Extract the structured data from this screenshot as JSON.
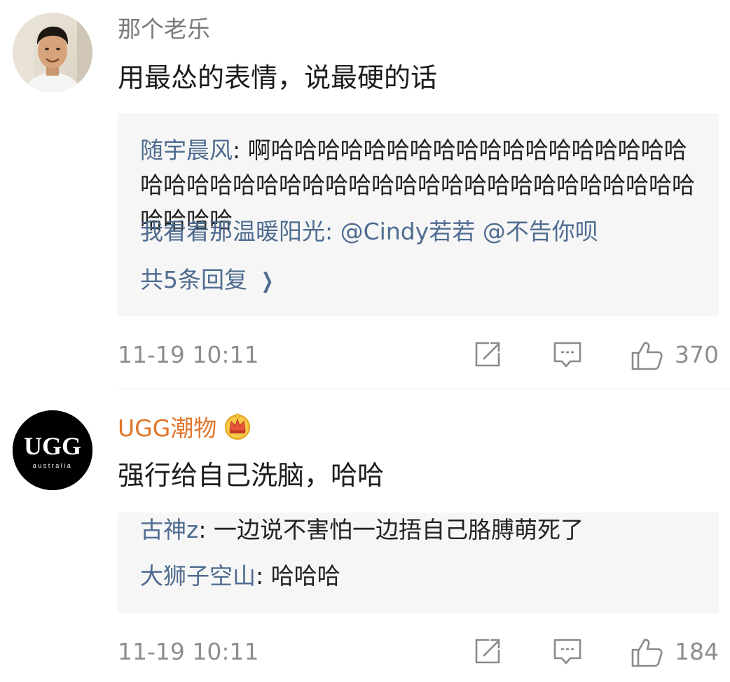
{
  "comments": [
    {
      "username": "那个老乐",
      "username_color": "#7b7b7b",
      "avatar": "person-photo-avatar",
      "text": "用最怂的表情，说最硬的话",
      "replies": [
        {
          "author": "随宇晨风",
          "separator": ": ",
          "text": "啊哈哈哈哈哈哈哈哈哈哈哈哈哈哈哈哈哈哈哈哈哈哈哈哈哈哈哈哈哈哈哈哈哈哈哈哈哈哈哈哈哈哈哈哈哈哈"
        },
        {
          "author": "我看着那温暖阳光",
          "separator": ": ",
          "text": "@Cindy若若 @不告你呗"
        }
      ],
      "more_replies": "共5条回复",
      "timestamp": "11-19 10:11",
      "likes": "370"
    },
    {
      "username": "UGG潮物",
      "username_color": "#e0762a",
      "avatar": "ugg-logo-avatar",
      "avatar_logo_text": "UGG",
      "avatar_logo_subtext": "australia",
      "badge": "crown-icon",
      "text": "强行给自己洗脑，哈哈",
      "replies": [
        {
          "author": "古神z",
          "separator": ": ",
          "text": "一边说不害怕一边捂自己胳膊萌死了"
        },
        {
          "author": "大狮子空山",
          "separator": ": ",
          "text": "哈哈哈"
        }
      ],
      "timestamp": "11-19 10:11",
      "likes": "184"
    }
  ],
  "colors": {
    "reply_author": "#4f6c90",
    "reply_bg": "#f6f6f6",
    "meta": "#8e8e8e"
  }
}
